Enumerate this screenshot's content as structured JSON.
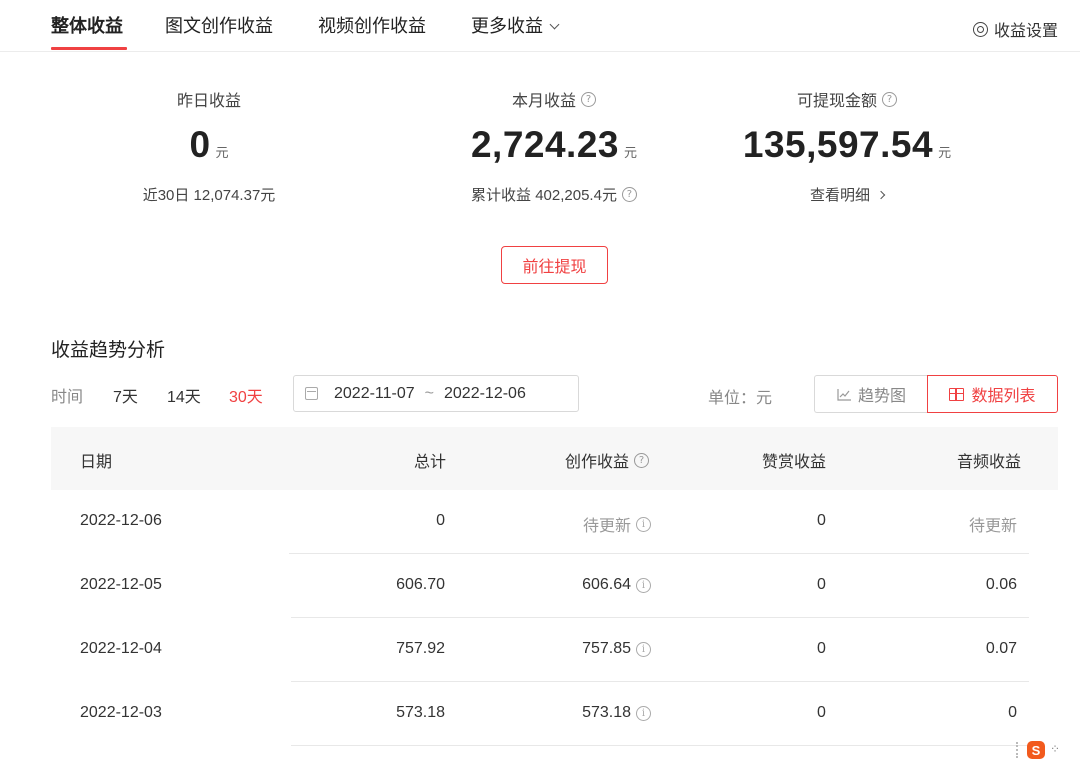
{
  "tabs": [
    {
      "label": "整体收益",
      "active": true
    },
    {
      "label": "图文创作收益",
      "active": false
    },
    {
      "label": "视频创作收益",
      "active": false
    },
    {
      "label": "更多收益",
      "active": false
    }
  ],
  "settings_label": "收益设置",
  "stats": {
    "yesterday": {
      "label": "昨日收益",
      "value": "0",
      "unit": "元",
      "sub": "近30日 12,074.37元"
    },
    "month": {
      "label": "本月收益",
      "value": "2,724.23",
      "unit": "元",
      "sub": "累计收益 402,205.4元"
    },
    "withdrawable": {
      "label": "可提现金额",
      "value": "135,597.54",
      "unit": "元",
      "sub": "查看明细"
    }
  },
  "withdraw_button": "前往提现",
  "trend": {
    "title": "收益趋势分析",
    "time_label": "时间",
    "ranges": [
      "7天",
      "14天",
      "30天"
    ],
    "active_range": "30天",
    "date_start": "2022-11-07",
    "date_sep": "~",
    "date_end": "2022-12-06",
    "unit_label": "单位：元",
    "view_trend": "趋势图",
    "view_list": "数据列表"
  },
  "table": {
    "headers": [
      "日期",
      "总计",
      "创作收益",
      "赞赏收益",
      "音频收益"
    ],
    "rows": [
      {
        "date": "2022-12-06",
        "total": "0",
        "creation": "待更新",
        "tip": "0",
        "audio": "待更新"
      },
      {
        "date": "2022-12-05",
        "total": "606.70",
        "creation": "606.64",
        "tip": "0",
        "audio": "0.06"
      },
      {
        "date": "2022-12-04",
        "total": "757.92",
        "creation": "757.85",
        "tip": "0",
        "audio": "0.07"
      },
      {
        "date": "2022-12-03",
        "total": "573.18",
        "creation": "573.18",
        "tip": "0",
        "audio": "0"
      }
    ]
  },
  "colors": {
    "accent": "#f04142",
    "header_bg": "#f7f7f7",
    "muted": "#999999"
  },
  "icons": [
    "chevron-down-icon",
    "settings-icon",
    "help-icon",
    "chevron-right-icon",
    "calendar-icon",
    "trend-chart-icon",
    "grid-table-icon",
    "info-icon"
  ]
}
